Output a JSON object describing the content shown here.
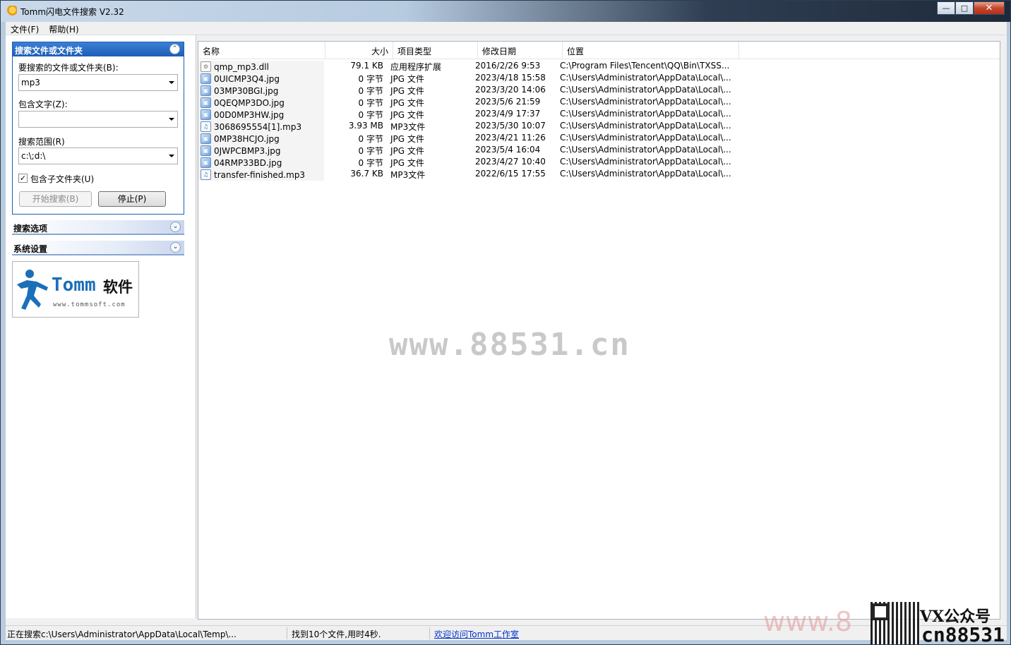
{
  "window": {
    "title": "Tomm闪电文件搜索 V2.32"
  },
  "menu": [
    "文件(F)",
    "帮助(H)"
  ],
  "search_group": {
    "title": "搜索文件或文件夹",
    "name_label": "要搜索的文件或文件夹(B):",
    "name_value": "mp3",
    "text_label": "包含文字(Z):",
    "text_value": "",
    "scope_label": "搜索范围(R)",
    "scope_value": "c:\\;d:\\",
    "subfolder_label": "包含子文件夹(U)",
    "subfolder_checked": true,
    "start_button": "开始搜索(B)",
    "stop_button": "停止(P)"
  },
  "options_group": {
    "title": "搜索选项"
  },
  "system_group": {
    "title": "系统设置"
  },
  "logo": {
    "brand": "Tomm",
    "brand_cn": "软件",
    "url": "www.tommsoft.com"
  },
  "columns": [
    "名称",
    "大小",
    "项目类型",
    "修改日期",
    "位置"
  ],
  "files": [
    {
      "name": "qmp_mp3.dll",
      "size": "79.1 KB",
      "type": "应用程序扩展",
      "date": "2016/2/26 9:53",
      "location": "C:\\Program Files\\Tencent\\QQ\\Bin\\TXSS...",
      "icon": "dll"
    },
    {
      "name": "0UICMP3Q4.jpg",
      "size": "0 字节",
      "type": "JPG 文件",
      "date": "2023/4/18 15:58",
      "location": "C:\\Users\\Administrator\\AppData\\Local\\...",
      "icon": "jpg"
    },
    {
      "name": "03MP30BGI.jpg",
      "size": "0 字节",
      "type": "JPG 文件",
      "date": "2023/3/20 14:06",
      "location": "C:\\Users\\Administrator\\AppData\\Local\\...",
      "icon": "jpg"
    },
    {
      "name": "0QEQMP3DO.jpg",
      "size": "0 字节",
      "type": "JPG 文件",
      "date": "2023/5/6 21:59",
      "location": "C:\\Users\\Administrator\\AppData\\Local\\...",
      "icon": "jpg"
    },
    {
      "name": "00D0MP3HW.jpg",
      "size": "0 字节",
      "type": "JPG 文件",
      "date": "2023/4/9 17:37",
      "location": "C:\\Users\\Administrator\\AppData\\Local\\...",
      "icon": "jpg"
    },
    {
      "name": "3068695554[1].mp3",
      "size": "3.93 MB",
      "type": "MP3文件",
      "date": "2023/5/30 10:07",
      "location": "C:\\Users\\Administrator\\AppData\\Local\\...",
      "icon": "mp3"
    },
    {
      "name": "0MP38HCJO.jpg",
      "size": "0 字节",
      "type": "JPG 文件",
      "date": "2023/4/21 11:26",
      "location": "C:\\Users\\Administrator\\AppData\\Local\\...",
      "icon": "jpg"
    },
    {
      "name": "0JWPCBMP3.jpg",
      "size": "0 字节",
      "type": "JPG 文件",
      "date": "2023/5/4 16:04",
      "location": "C:\\Users\\Administrator\\AppData\\Local\\...",
      "icon": "jpg"
    },
    {
      "name": "04RMP33BD.jpg",
      "size": "0 字节",
      "type": "JPG 文件",
      "date": "2023/4/27 10:40",
      "location": "C:\\Users\\Administrator\\AppData\\Local\\...",
      "icon": "jpg"
    },
    {
      "name": "transfer-finished.mp3",
      "size": "36.7 KB",
      "type": "MP3文件",
      "date": "2022/6/15 17:55",
      "location": "C:\\Users\\Administrator\\AppData\\Local\\...",
      "icon": "mp3"
    }
  ],
  "watermark": "www.88531.cn",
  "status": {
    "searching": "正在搜索c:\\Users\\Administrator\\AppData\\Local\\Temp\\...",
    "result": "找到10个文件,用时4秒.",
    "link": "欢迎访问Tomm工作室"
  },
  "corner": {
    "site": "www.8",
    "vx": "VX公众号",
    "code": "cn88531"
  },
  "colors": {
    "accent": "#1d5eb6",
    "link": "#0033cc"
  }
}
